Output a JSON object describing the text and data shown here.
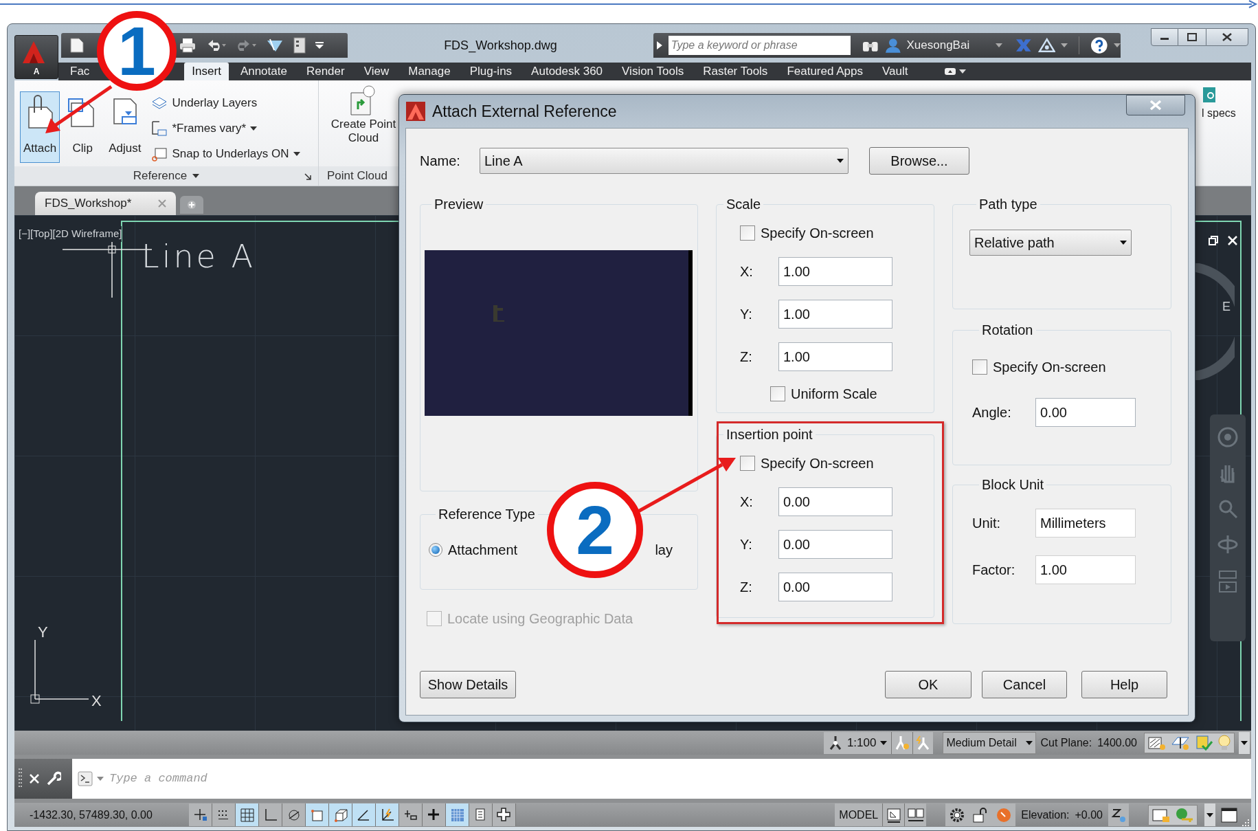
{
  "window": {
    "title": "FDS_Workshop.dwg",
    "app_button_letter": "A"
  },
  "search": {
    "placeholder": "Type a keyword or phrase"
  },
  "user": "XuesongBai",
  "ribbon_tabs": [
    {
      "label": "Fac",
      "selected": false
    },
    {
      "label": "Insert",
      "selected": true
    },
    {
      "label": "Annotate",
      "selected": false
    },
    {
      "label": "Render",
      "selected": false
    },
    {
      "label": "View",
      "selected": false
    },
    {
      "label": "Manage",
      "selected": false
    },
    {
      "label": "Plug-ins",
      "selected": false
    },
    {
      "label": "Autodesk 360",
      "selected": false
    },
    {
      "label": "Vision Tools",
      "selected": false
    },
    {
      "label": "Raster Tools",
      "selected": false
    },
    {
      "label": "Featured Apps",
      "selected": false
    },
    {
      "label": "Vault",
      "selected": false
    }
  ],
  "ribbon": {
    "large_buttons": [
      {
        "label": "Attach",
        "selected": true
      },
      {
        "label": "Clip",
        "selected": false
      },
      {
        "label": "Adjust",
        "selected": false
      }
    ],
    "small_buttons": [
      {
        "label": "Underlay Layers",
        "dropdown": false
      },
      {
        "label": "*Frames vary*",
        "dropdown": true
      },
      {
        "label": "Snap to Underlays ON",
        "dropdown": true
      }
    ],
    "reference_panel": "Reference",
    "point_cloud_button": "Create Point Cloud",
    "point_cloud_panel": "Point Cloud",
    "partial_label": "l specs"
  },
  "document_tab": "FDS_Workshop*",
  "viewport": {
    "label": "[−][Top][2D Wireframe]",
    "drawing_text": "Line A",
    "compass": "E",
    "ucs_x": "X",
    "ucs_y": "Y"
  },
  "canvas_status": {
    "scale": "1:100",
    "detail": "Medium Detail",
    "cut_plane_label": "Cut Plane:",
    "cut_plane": "1400.00"
  },
  "command_line": {
    "placeholder": "Type a command"
  },
  "status_bar": {
    "coordinates": "-1432.30, 57489.30, 0.00",
    "toggles": [
      {
        "on": false
      },
      {
        "on": false
      },
      {
        "on": true
      },
      {
        "on": false
      },
      {
        "on": false
      },
      {
        "on": true
      },
      {
        "on": true
      },
      {
        "on": true
      },
      {
        "on": true
      },
      {
        "on": false
      },
      {
        "on": false
      },
      {
        "on": true
      },
      {
        "on": false
      },
      {
        "on": false
      }
    ],
    "model": "MODEL",
    "elevation_label": "Elevation:",
    "elevation": "+0.00"
  },
  "dialog": {
    "title": "Attach External Reference",
    "name_label": "Name:",
    "name_value": "Line A",
    "browse": "Browse...",
    "preview_label": "Preview",
    "scale": {
      "title": "Scale",
      "specify": {
        "label": "Specify On-screen",
        "checked": false
      },
      "fields": [
        {
          "label": "X:",
          "value": "1.00"
        },
        {
          "label": "Y:",
          "value": "1.00"
        },
        {
          "label": "Z:",
          "value": "1.00"
        }
      ],
      "uniform": {
        "label": "Uniform Scale",
        "checked": false
      }
    },
    "insertion": {
      "title": "Insertion point",
      "specify": {
        "label": "Specify On-screen",
        "checked": false
      },
      "fields": [
        {
          "label": "X:",
          "value": "0.00"
        },
        {
          "label": "Y:",
          "value": "0.00"
        },
        {
          "label": "Z:",
          "value": "0.00"
        }
      ]
    },
    "path_type": {
      "title": "Path type",
      "value": "Relative path"
    },
    "rotation": {
      "title": "Rotation",
      "specify": {
        "label": "Specify On-screen",
        "checked": false
      },
      "angle_label": "Angle:",
      "angle": "0.00"
    },
    "block_unit": {
      "title": "Block Unit",
      "unit_label": "Unit:",
      "unit": "Millimeters",
      "factor_label": "Factor:",
      "factor": "1.00"
    },
    "reference_type": {
      "title": "Reference Type",
      "options": [
        {
          "label": "Attachment",
          "selected": true
        }
      ],
      "hidden_option_fragment": "lay"
    },
    "locate": {
      "label": "Locate using Geographic Data",
      "checked": false,
      "disabled": true
    },
    "buttons": [
      "Show Details",
      "OK",
      "Cancel",
      "Help"
    ]
  },
  "callouts": [
    {
      "number": "1"
    },
    {
      "number": "2"
    }
  ]
}
